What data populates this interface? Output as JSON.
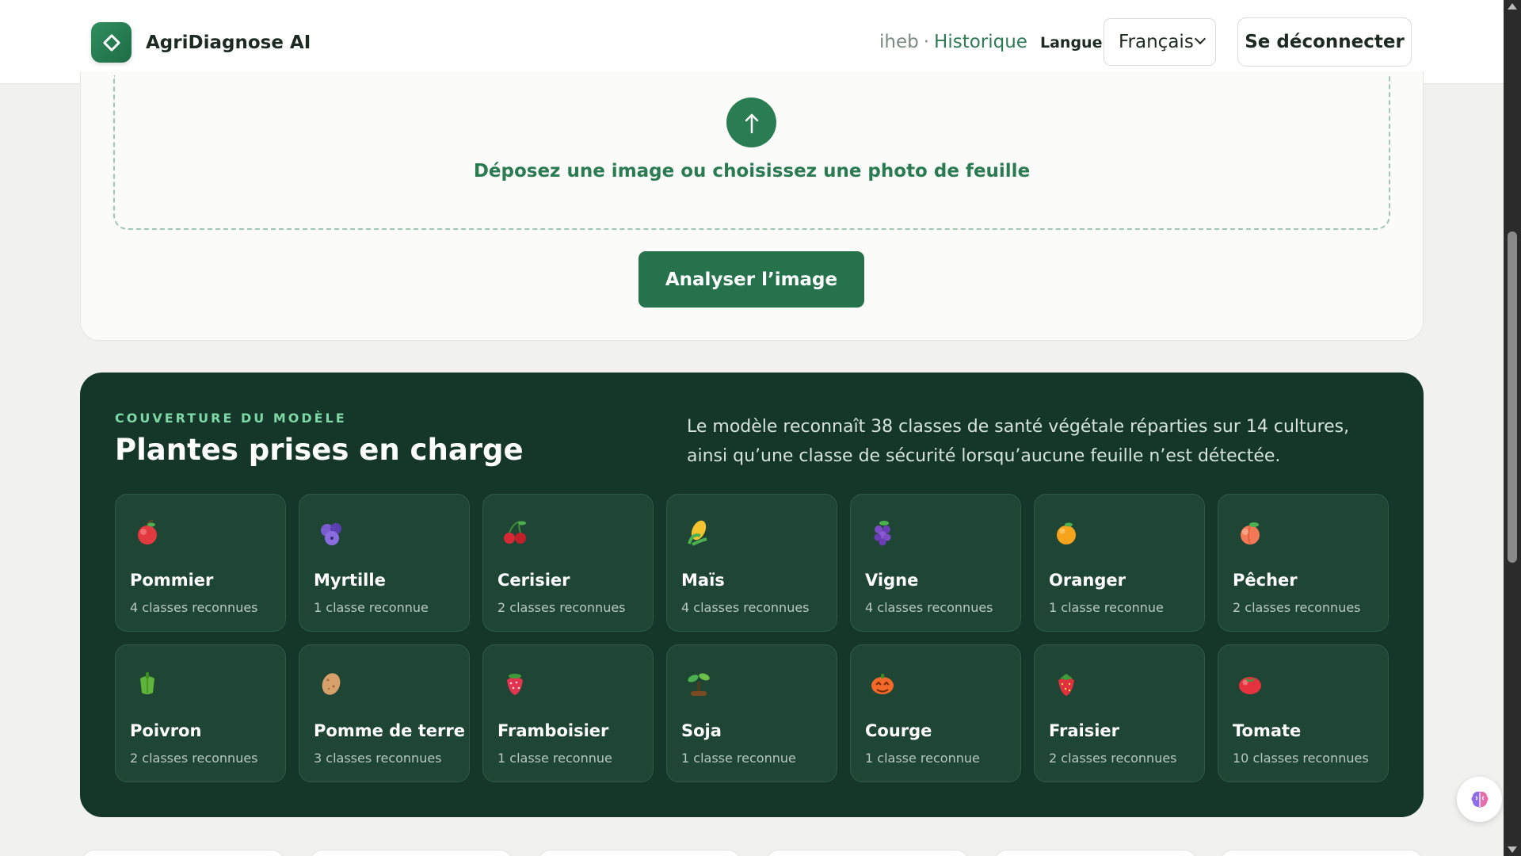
{
  "header": {
    "brand": "AgriDiagnose AI",
    "user": "iheb",
    "separator": "·",
    "history_link": "Historique",
    "language_label": "Langue",
    "language_value": "Français",
    "logout_label": "Se déconnecter"
  },
  "upload": {
    "icon": "upload-arrow-icon",
    "prompt": "Déposez une image ou choisissez une photo de feuille",
    "analyze_label": "Analyser l’image"
  },
  "coverage": {
    "eyebrow": "COUVERTURE DU MODÈLE",
    "title": "Plantes prises en charge",
    "description": "Le modèle reconnaît 38 classes de santé végétale réparties sur 14 cultures, ainsi qu’une classe de sécurité lorsqu’aucune feuille n’est détectée.",
    "plants": [
      {
        "name": "Pommier",
        "count": "4 classes reconnues",
        "icon": "apple"
      },
      {
        "name": "Myrtille",
        "count": "1 classe reconnue",
        "icon": "blueberry"
      },
      {
        "name": "Cerisier",
        "count": "2 classes reconnues",
        "icon": "cherry"
      },
      {
        "name": "Maïs",
        "count": "4 classes reconnues",
        "icon": "corn"
      },
      {
        "name": "Vigne",
        "count": "4 classes reconnues",
        "icon": "grape"
      },
      {
        "name": "Oranger",
        "count": "1 classe reconnue",
        "icon": "orange"
      },
      {
        "name": "Pêcher",
        "count": "2 classes reconnues",
        "icon": "peach"
      },
      {
        "name": "Poivron",
        "count": "2 classes reconnues",
        "icon": "pepper"
      },
      {
        "name": "Pomme de terre",
        "count": "3 classes reconnues",
        "icon": "potato"
      },
      {
        "name": "Framboisier",
        "count": "1 classe reconnue",
        "icon": "raspberry"
      },
      {
        "name": "Soja",
        "count": "1 classe reconnue",
        "icon": "seedling"
      },
      {
        "name": "Courge",
        "count": "1 classe reconnue",
        "icon": "squash"
      },
      {
        "name": "Fraisier",
        "count": "2 classes reconnues",
        "icon": "strawberry"
      },
      {
        "name": "Tomate",
        "count": "10 classes reconnues",
        "icon": "tomato"
      }
    ]
  },
  "colors": {
    "brand_green": "#2a7d53",
    "panel_dark": "#14372a",
    "card_dark": "#1f4535",
    "eyebrow_mint": "#7fd7a5"
  },
  "floating_button": {
    "icon": "brain-icon"
  }
}
